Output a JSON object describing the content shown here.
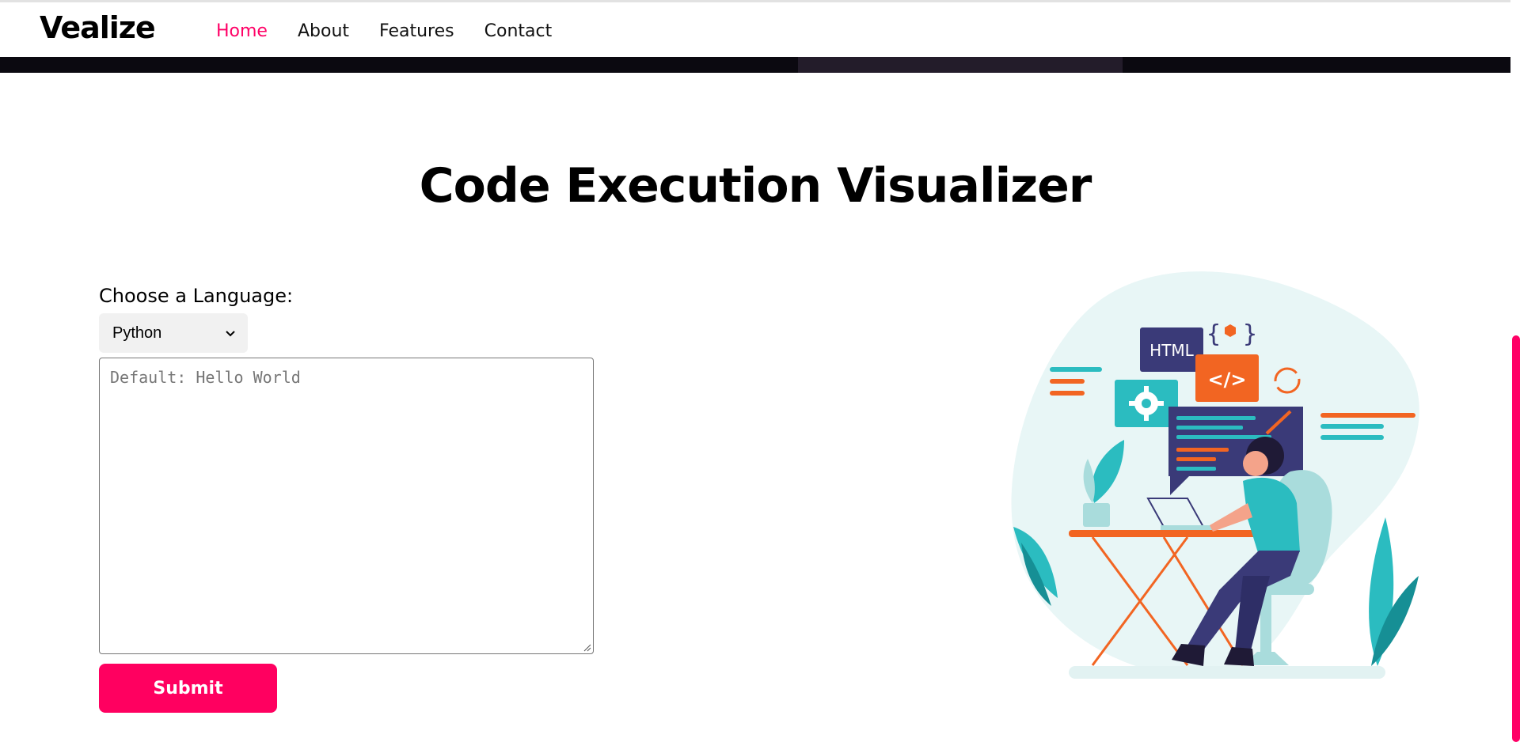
{
  "brand": {
    "name": "Vealize"
  },
  "nav": {
    "items": [
      {
        "label": "Home"
      },
      {
        "label": "About"
      },
      {
        "label": "Features"
      },
      {
        "label": "Contact"
      }
    ]
  },
  "main": {
    "title": "Code Execution Visualizer",
    "language_label": "Choose a Language:",
    "language_selected": "Python",
    "code_placeholder": "Default: Hello World",
    "submit_label": "Submit"
  },
  "illustration": {
    "html_badge": "HTML",
    "code_badge": "</>"
  },
  "colors": {
    "accent": "#ff0066",
    "teal": "#2bbcc0",
    "navy": "#3a3a78",
    "orange": "#f26522"
  }
}
